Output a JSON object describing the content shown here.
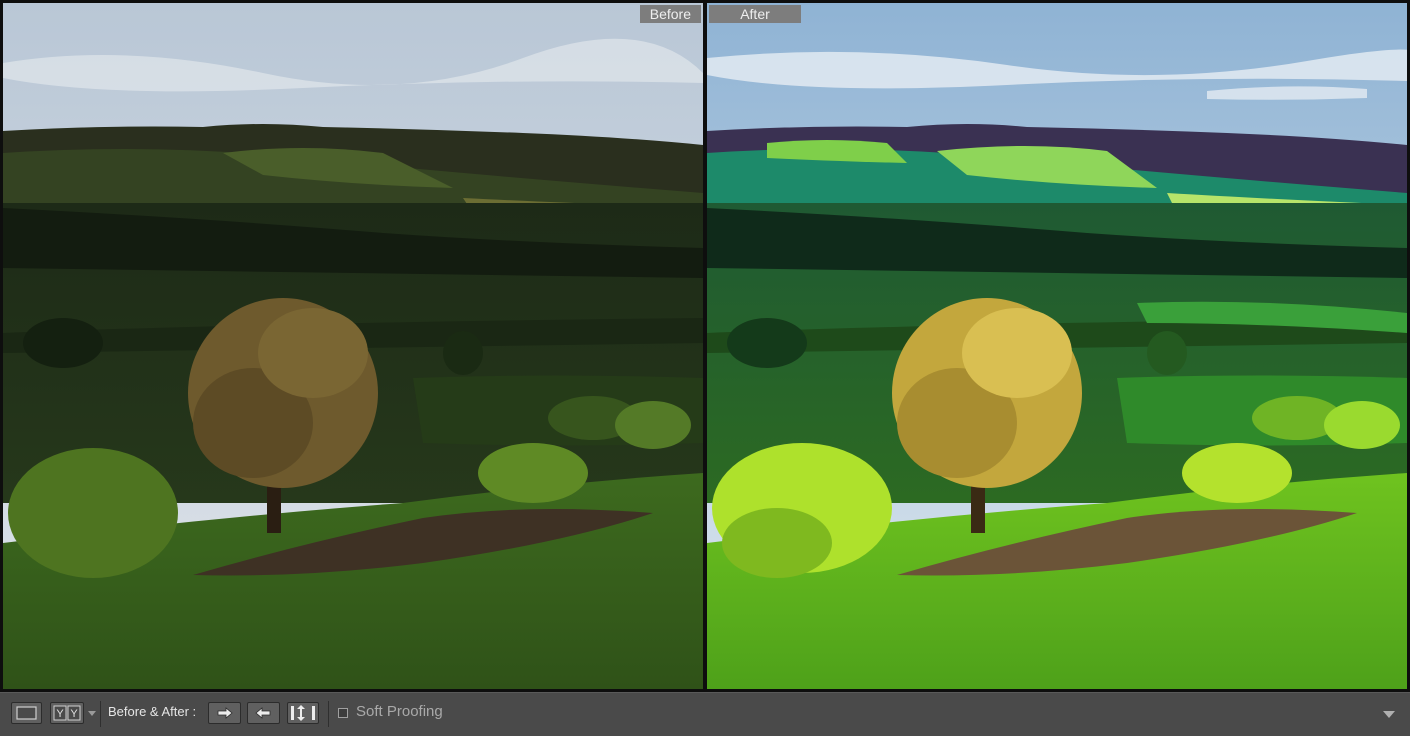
{
  "panes": {
    "before": {
      "label": "Before"
    },
    "after": {
      "label": "After"
    }
  },
  "toolbar": {
    "before_after_label": "Before & After :",
    "soft_proofing_label": "Soft Proofing",
    "soft_proofing_checked": false
  },
  "icons": {
    "loupe_view": "single-frame-icon",
    "compare_view": "yy-compare-icon",
    "view_dropdown": "triangle-down-icon",
    "copy_before_to_after": "arrow-right-icon",
    "copy_after_to_before": "arrow-left-icon",
    "swap": "swap-icon",
    "toolbar_menu": "triangle-down-icon"
  },
  "colors": {
    "label_bg": "#7d7d7d",
    "toolbar_bg": "#4a4a4a",
    "button_bg": "#606060"
  }
}
